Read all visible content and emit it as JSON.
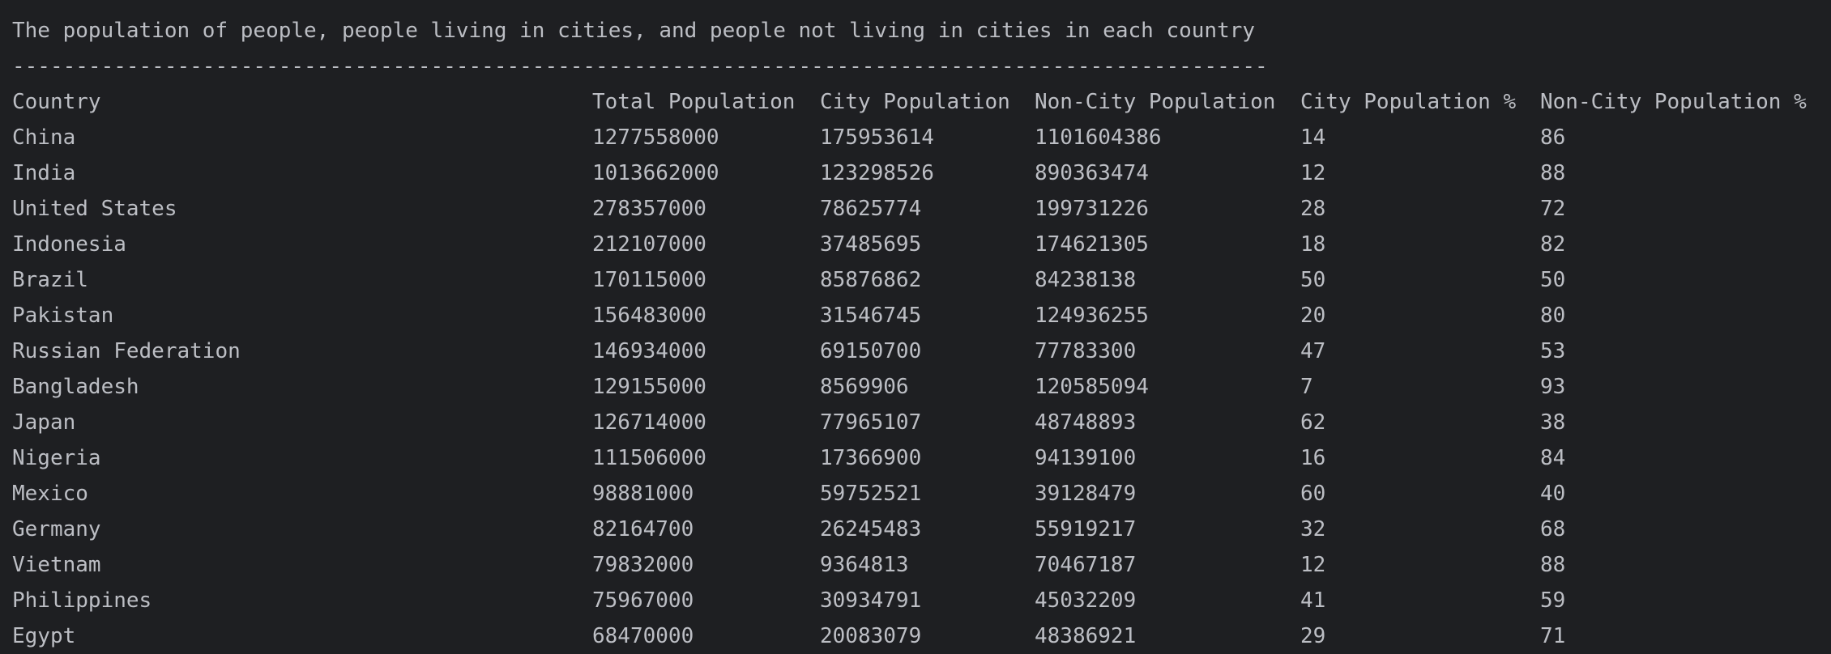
{
  "output": {
    "title": "The population of people, people living in cities, and people not living in cities in each country",
    "separator": "---------------------------------------------------------------------------------------------------",
    "headers": [
      "Country",
      "Total Population",
      "City Population",
      "Non-City Population",
      "City Population %",
      "Non-City Population %"
    ],
    "rows": [
      [
        "China",
        "1277558000",
        "175953614",
        "1101604386",
        "14",
        "86"
      ],
      [
        "India",
        "1013662000",
        "123298526",
        "890363474",
        "12",
        "88"
      ],
      [
        "United States",
        "278357000",
        "78625774",
        "199731226",
        "28",
        "72"
      ],
      [
        "Indonesia",
        "212107000",
        "37485695",
        "174621305",
        "18",
        "82"
      ],
      [
        "Brazil",
        "170115000",
        "85876862",
        "84238138",
        "50",
        "50"
      ],
      [
        "Pakistan",
        "156483000",
        "31546745",
        "124936255",
        "20",
        "80"
      ],
      [
        "Russian Federation",
        "146934000",
        "69150700",
        "77783300",
        "47",
        "53"
      ],
      [
        "Bangladesh",
        "129155000",
        "8569906",
        "120585094",
        "7",
        "93"
      ],
      [
        "Japan",
        "126714000",
        "77965107",
        "48748893",
        "62",
        "38"
      ],
      [
        "Nigeria",
        "111506000",
        "17366900",
        "94139100",
        "16",
        "84"
      ],
      [
        "Mexico",
        "98881000",
        "59752521",
        "39128479",
        "60",
        "40"
      ],
      [
        "Germany",
        "82164700",
        "26245483",
        "55919217",
        "32",
        "68"
      ],
      [
        "Vietnam",
        "79832000",
        "9364813",
        "70467187",
        "12",
        "88"
      ],
      [
        "Philippines",
        "75967000",
        "30934791",
        "45032209",
        "41",
        "59"
      ],
      [
        "Egypt",
        "68470000",
        "20083079",
        "48386921",
        "29",
        "71"
      ]
    ]
  }
}
